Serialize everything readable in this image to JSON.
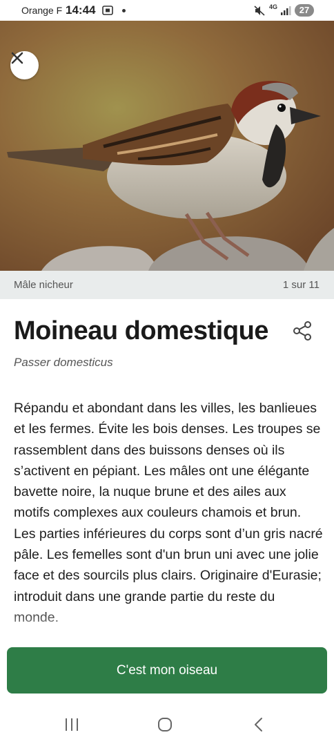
{
  "status_bar": {
    "carrier": "Orange F",
    "time": "14:44",
    "network": "4G",
    "battery": "27"
  },
  "photo": {
    "caption": "Mâle nicheur",
    "position": "1 sur 11"
  },
  "species": {
    "common_name": "Moineau domestique",
    "scientific_name": "Passer domesticus",
    "description": "Répandu et abondant dans les villes, les banlieues et les fermes. Évite les bois denses. Les troupes se rassemblent dans des buissons denses où ils s’activent en pépiant. Les mâles ont une élégante bavette noire, la nuque brune et des ailes aux motifs complexes aux couleurs chamois et brun. Les parties inférieures du corps sont d’un gris nacré pâle. Les femelles sont d'un brun uni avec une jolie face et des sourcils plus clairs. Originaire d'Eurasie; introduit dans une grande partie du reste du monde."
  },
  "actions": {
    "confirm_label": "C'est mon oiseau"
  },
  "icons": {
    "close": "close-icon",
    "share": "share-icon",
    "nav_recents": "recents-icon",
    "nav_home": "home-icon",
    "nav_back": "back-icon"
  },
  "colors": {
    "primary": "#2e7d47",
    "caption_bar": "#e9ecec"
  }
}
